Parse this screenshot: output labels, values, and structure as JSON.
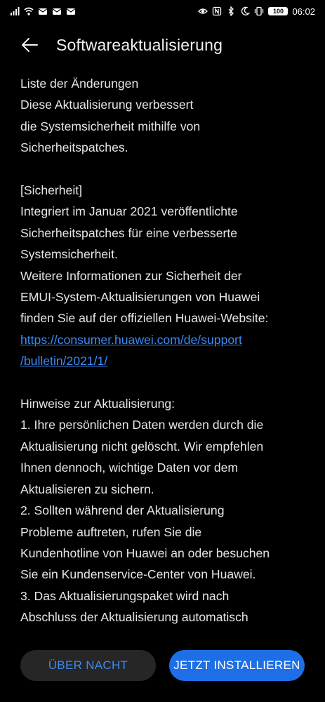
{
  "status_bar": {
    "time": "06:02",
    "battery": "100",
    "left_icons": [
      "signal-icon",
      "wifi-icon",
      "mail-icon",
      "mail-icon",
      "mail-icon"
    ],
    "right_icons": [
      "eye-icon",
      "nfc-icon",
      "bluetooth-icon",
      "moon-icon",
      "vibrate-icon"
    ]
  },
  "header": {
    "title": "Softwareaktualisierung",
    "back_icon": "arrow-left-icon"
  },
  "content": {
    "changes_heading": "Liste der Änderungen",
    "intro_lines": [
      "Diese Aktualisierung verbessert",
      "die Systemsicherheit mithilfe von",
      "Sicherheitspatches."
    ],
    "security_heading": "[Sicherheit]",
    "security_lines": [
      "Integriert im Januar 2021 veröffentlichte",
      "Sicherheitspatches für eine verbesserte",
      "Systemsicherheit.",
      "Weitere Informationen zur Sicherheit der",
      "EMUI-System-Aktualisierungen von Huawei",
      "finden Sie auf der offiziellen Huawei-Website:"
    ],
    "link_lines": [
      "https://consumer.huawei.com/de/support",
      "/bulletin/2021/1/"
    ],
    "notes_heading": "Hinweise zur Aktualisierung:",
    "notes_lines": [
      "1. Ihre persönlichen Daten werden durch die",
      "Aktualisierung nicht gelöscht. Wir empfehlen",
      "Ihnen dennoch, wichtige Daten vor dem",
      "Aktualisieren zu sichern.",
      "2. Sollten während der Aktualisierung",
      "Probleme auftreten, rufen Sie die",
      "Kundenhotline von Huawei an oder besuchen",
      "Sie ein Kundenservice-Center von Huawei.",
      "3. Das Aktualisierungspaket wird nach",
      "Abschluss der Aktualisierung automatisch"
    ]
  },
  "actions": {
    "later_label": "ÜBER NACHT",
    "install_label": "JETZT INSTALLIEREN"
  },
  "colors": {
    "background": "#000000",
    "accent": "#1e6fe6",
    "link": "#3d8bf2",
    "secondary_button": "#262626"
  }
}
